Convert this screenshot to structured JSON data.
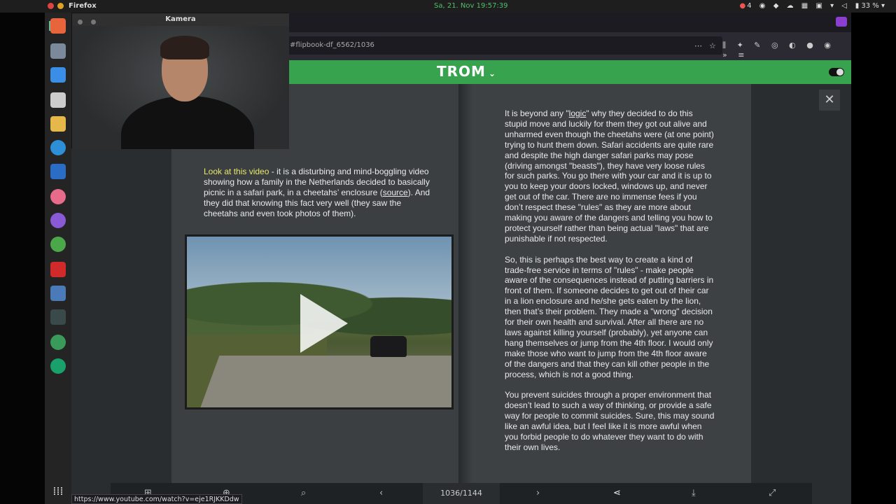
{
  "system": {
    "app_name": "Firefox",
    "datetime": "Sa, 21. Nov  19:57:39",
    "tray_badge": "4",
    "battery": "33 %"
  },
  "browser": {
    "url": "#flipbook-df_6562/1036",
    "status_url": "https://www.youtube.com/watch?v=eje1RJKKDdw"
  },
  "site": {
    "logo": "TROM"
  },
  "webcam": {
    "title": "Kamera"
  },
  "left_page": {
    "highlight": "Look at this video",
    "text_before_link": " - it is a disturbing and mind-boggling video showing how a family in the Netherlands decided to basically picnic in a safari park, in a cheetahs’ enclosure (",
    "link": "source",
    "text_after_link": "). And they did that knowing this fact very well (they saw the cheetahs and even took photos of them)."
  },
  "right_page": {
    "p1_a": "It is beyond any \"",
    "p1_link": "logic",
    "p1_b": "\" why they decided to do this stupid move and luckily for them they got out alive and unharmed even though the cheetahs were (at one point) trying to hunt them down. Safari accidents are quite rare and despite the high danger safari parks may pose (driving amongst \"beasts\"), they have very loose rules for such parks. You go there with your car and it is up to you to keep your doors locked, windows up, and never get out of the car. There are no immense fees if you don’t respect these \"rules\" as they are more about making you aware of the dangers and telling you how to protect yourself rather than being actual \"laws\" that are punishable if not respected.",
    "p2": "So, this is perhaps the best way to create a kind of trade-free service in terms of \"rules\" - make people aware of the consequences instead of putting barriers in front of them. If someone decides to get out of their car in a lion enclosure and he/she gets eaten by the lion, then that’s their problem. They made a \"wrong\" decision for their own health and survival. After all there are no laws against killing yourself (probably), yet anyone can hang themselves or jump from the 4th floor. I would only make those who want to jump from the 4th floor aware of the dangers and that they can kill other people in the process, which is not a good thing.",
    "p3": "You prevent suicides through a proper environment that doesn’t lead to such a way of thinking, or provide a safe way for people to commit suicides. Sure, this may sound like an awful idea, but I feel like it is more awful when you forbid people to do whatever they want to do with their own lives."
  },
  "flipbook": {
    "page_indicator": "1036/1144"
  },
  "icons": {
    "close": "close-icon",
    "prev": "chevron-left-icon",
    "next": "chevron-right-icon",
    "share": "share-icon",
    "download": "download-icon",
    "fullscreen": "fullscreen-icon",
    "zoom": "zoom-icon",
    "play": "play-icon"
  },
  "colors": {
    "site_header": "#38a34e",
    "highlight": "#e9e86a",
    "clock": "#4fc06a"
  }
}
